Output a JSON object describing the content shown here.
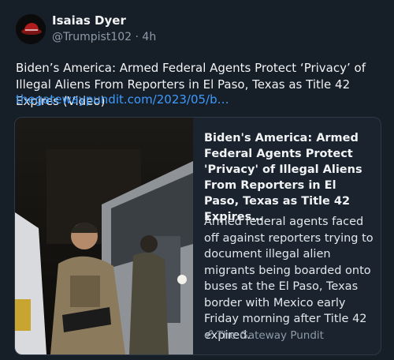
{
  "author": {
    "display_name": "Isaias Dyer",
    "handle": "@Trumpist102",
    "separator": "·",
    "time": "4h",
    "avatar_icon": "hat-avatar-icon"
  },
  "post": {
    "text": "Biden’s America: Armed Federal Agents Protect ‘Privacy’ of Illegal Aliens From Reporters in El Paso, Texas as Title 42 Expires (Video)",
    "link_text": "thegatewaypundit.com/2023/05/b…"
  },
  "link_card": {
    "title": "Biden's America: Armed Federal Agents Protect 'Privacy' of Illegal Aliens From Reporters in El Paso, Texas as Title 42 Expires…",
    "description": "Armed federal agents faced off against reporters trying to document illegal alien migrants being boarded onto buses at the El Paso, Texas border with Mexico early Friday morning after Title 42 expired.",
    "source": "The Gateway Pundit",
    "source_icon": "link-icon"
  },
  "colors": {
    "background": "#161e27",
    "link": "#3d9bff",
    "muted": "#8d9aa8",
    "card_border": "#2d3947"
  }
}
